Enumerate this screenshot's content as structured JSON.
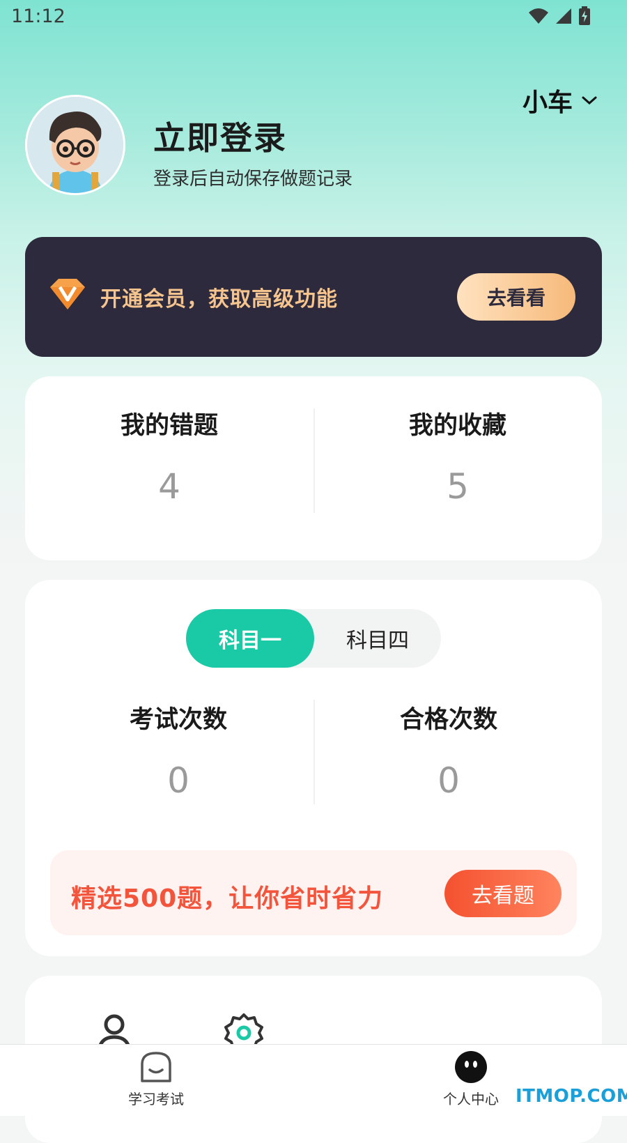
{
  "status_bar": {
    "time": "11:12",
    "icons": [
      "wifi-icon",
      "signal-icon",
      "battery-charging-icon"
    ]
  },
  "header": {
    "login_title": "立即登录",
    "login_subtitle": "登录后自动保存做题记录",
    "vehicle_select": "小车"
  },
  "vip_banner": {
    "text": "开通会员，获取高级功能",
    "button": "去看看"
  },
  "stats": {
    "wrong_label": "我的错题",
    "wrong_count": "4",
    "favorite_label": "我的收藏",
    "favorite_count": "5"
  },
  "exam": {
    "tabs": [
      {
        "label": "科目一",
        "active": true
      },
      {
        "label": "科目四",
        "active": false
      }
    ],
    "exam_count_label": "考试次数",
    "exam_count": "0",
    "pass_count_label": "合格次数",
    "pass_count": "0",
    "promo_text": "精选500题，让你省时省力",
    "promo_button": "去看题"
  },
  "bottom_nav": [
    {
      "label": "学习考试",
      "icon": "smile-box-icon"
    },
    {
      "label": "个人中心",
      "icon": "face-icon",
      "active": true
    }
  ],
  "watermark": "ITMOP.COM",
  "colors": {
    "accent": "#1ac9a6",
    "vip_bg": "#2c2a3c",
    "vip_text": "#f6c48e",
    "promo_red": "#f2543c"
  }
}
